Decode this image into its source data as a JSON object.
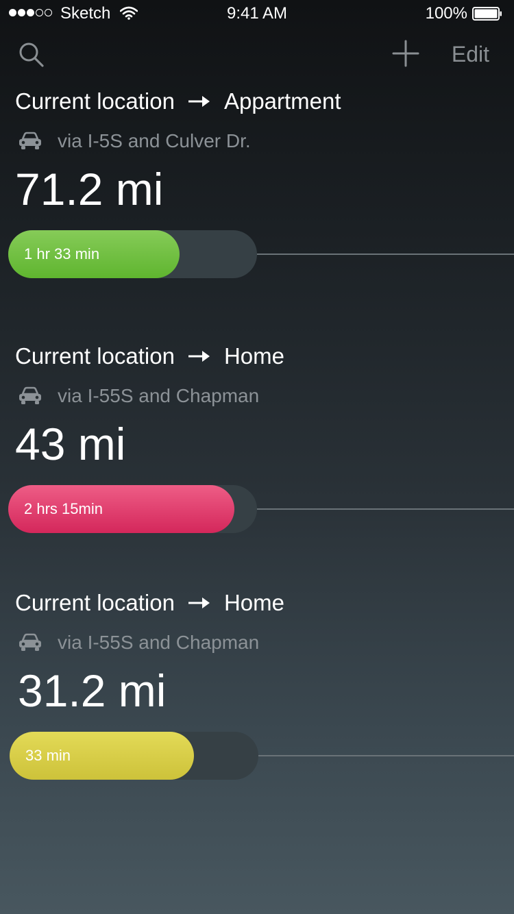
{
  "status_bar": {
    "carrier": "Sketch",
    "time": "9:41 AM",
    "battery": "100%",
    "signal_bars_filled": 3,
    "signal_bars_total": 5
  },
  "nav": {
    "search_icon": "search-icon",
    "add_icon": "plus-icon",
    "edit_label": "Edit"
  },
  "routes": [
    {
      "from": "Current location",
      "to": "Appartment",
      "via": "via I-5S and Culver Dr.",
      "distance": "71.2 mi",
      "eta": "1 hr 33 min",
      "traffic_fraction": 0.69,
      "color_start": "#86cb58",
      "color_end": "#5fb52f"
    },
    {
      "from": "Current location",
      "to": "Home",
      "via": "via I-55S and Chapman",
      "distance": "43 mi",
      "eta": "2 hrs 15min",
      "traffic_fraction": 0.91,
      "color_start": "#ee5d86",
      "color_end": "#d4275b"
    },
    {
      "from": "Current location",
      "to": "Home",
      "via": "via I-55S and Chapman",
      "distance": "31.2 mi",
      "eta": "33 min",
      "traffic_fraction": 0.74,
      "color_start": "#e3da57",
      "color_end": "#cdc23a"
    }
  ]
}
